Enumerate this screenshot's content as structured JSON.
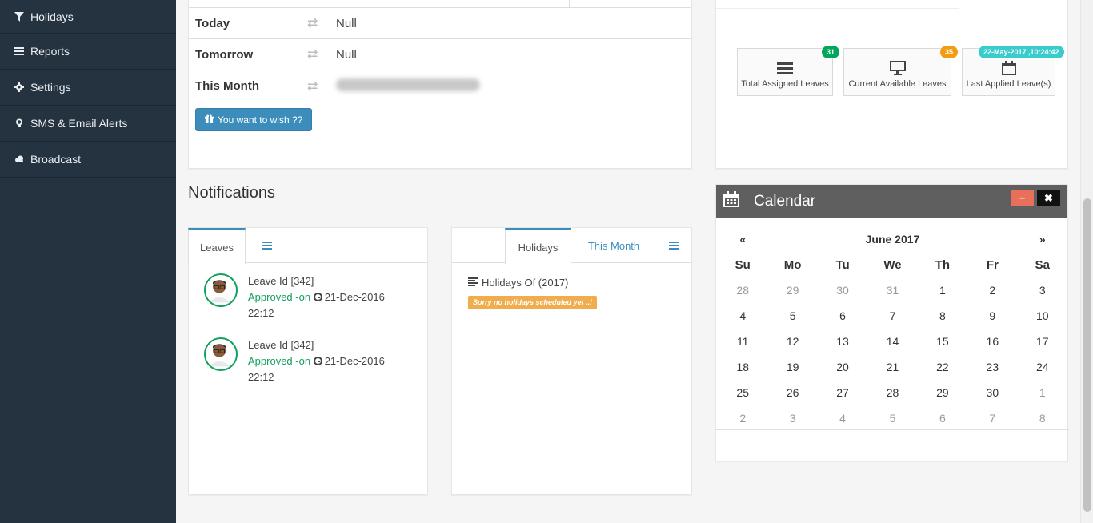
{
  "sidebar": {
    "items": [
      {
        "label": "Holidays",
        "icon": "filter-icon"
      },
      {
        "label": "Reports",
        "icon": "list-icon"
      },
      {
        "label": "Settings",
        "icon": "gear-icon"
      },
      {
        "label": "SMS & Email Alerts",
        "icon": "lightbulb-icon"
      },
      {
        "label": "Broadcast",
        "icon": "cloud-icon"
      }
    ]
  },
  "wish": {
    "rows": [
      {
        "label": "Today",
        "value": "Null"
      },
      {
        "label": "Tomorrow",
        "value": "Null"
      },
      {
        "label": "This Month",
        "value": ""
      }
    ],
    "button_label": "You want to wish ??"
  },
  "stats": [
    {
      "label": "Total Assigned Leaves",
      "badge": "31",
      "badge_color": "#00a65a",
      "icon": "bars-icon"
    },
    {
      "label": "Current Available Leaves",
      "badge": "35",
      "badge_color": "#f39c12",
      "icon": "monitor-icon"
    },
    {
      "label": "Last Applied Leave(s)",
      "badge": "22-May-2017 ,10:24:42",
      "badge_color": "#39cccc",
      "icon": "calendar-icon"
    }
  ],
  "notifications": {
    "title": "Notifications",
    "leaves_tab": "Leaves",
    "leaves": [
      {
        "id": "Leave Id [342]",
        "status": "Approved -on",
        "date": "21-Dec-2016",
        "time": "22:12"
      },
      {
        "id": "Leave Id [342]",
        "status": "Approved -on",
        "date": "21-Dec-2016",
        "time": "22:12"
      }
    ],
    "holidays_tab": "Holidays",
    "this_month_tab": "This Month",
    "holidays_heading": "Holidays Of (2017)",
    "no_holidays": "Sorry no holidays scheduled yet ..!"
  },
  "calendar": {
    "title": "Calendar",
    "month": "June 2017",
    "prev": "«",
    "next": "»",
    "minimize": "−",
    "close": "✖",
    "weekdays": [
      "Su",
      "Mo",
      "Tu",
      "We",
      "Th",
      "Fr",
      "Sa"
    ],
    "weeks": [
      [
        "28",
        "29",
        "30",
        "31",
        "1",
        "2",
        "3"
      ],
      [
        "4",
        "5",
        "6",
        "7",
        "8",
        "9",
        "10"
      ],
      [
        "11",
        "12",
        "13",
        "14",
        "15",
        "16",
        "17"
      ],
      [
        "18",
        "19",
        "20",
        "21",
        "22",
        "23",
        "24"
      ],
      [
        "25",
        "26",
        "27",
        "28",
        "29",
        "30",
        "1"
      ],
      [
        "2",
        "3",
        "4",
        "5",
        "6",
        "7",
        "8"
      ]
    ],
    "off_days": [
      [
        0,
        0
      ],
      [
        0,
        1
      ],
      [
        0,
        2
      ],
      [
        0,
        3
      ],
      [
        4,
        6
      ],
      [
        5,
        0
      ],
      [
        5,
        1
      ],
      [
        5,
        2
      ],
      [
        5,
        3
      ],
      [
        5,
        4
      ],
      [
        5,
        5
      ],
      [
        5,
        6
      ]
    ]
  }
}
